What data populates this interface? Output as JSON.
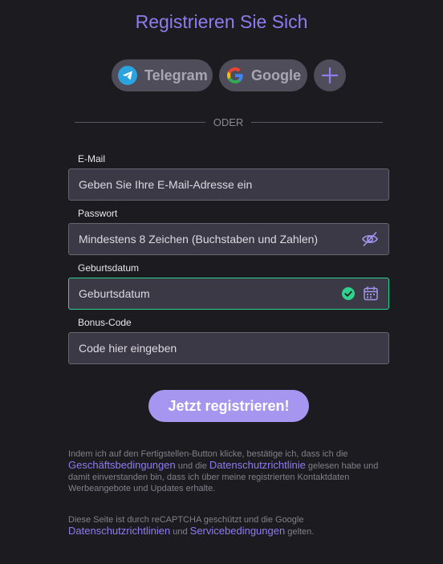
{
  "title": "Registrieren Sie Sich",
  "social": {
    "telegram": "Telegram",
    "google": "Google"
  },
  "divider": "ODER",
  "fields": {
    "email": {
      "label": "E-Mail",
      "placeholder": "Geben Sie Ihre E-Mail-Adresse ein"
    },
    "password": {
      "label": "Passwort",
      "placeholder": "Mindestens 8 Zeichen (Buchstaben und Zahlen)"
    },
    "birthdate": {
      "label": "Geburtsdatum",
      "placeholder": "Geburtsdatum"
    },
    "bonus": {
      "label": "Bonus-Code",
      "placeholder": "Code hier eingeben"
    }
  },
  "submit": "Jetzt registrieren!",
  "terms": {
    "prefix": "Indem ich auf den Fertigstellen-Button klicke, bestätige ich, dass ich die",
    "link1": "Geschäftsbedingungen",
    "mid": " und die ",
    "link2": "Datenschutzrichtlinie",
    "suffix": " gelesen habe und damit einverstanden bin, dass ich über meine registrierten Kontaktdaten Werbeangebote und Updates erhalte."
  },
  "recaptcha": {
    "prefix": "Diese Seite ist durch reCAPTCHA geschützt und die Google",
    "link1": "Datenschutzrichtlinien",
    "mid": " und ",
    "link2": "Servicebedingungen",
    "suffix": " gelten."
  },
  "colors": {
    "accent": "#8f7cf0",
    "valid": "#2fd38f",
    "telegram": "#2aa3df"
  },
  "icons": [
    "telegram-icon",
    "google-icon",
    "plus-icon",
    "eye-off-icon",
    "check-circle-icon",
    "calendar-icon"
  ]
}
